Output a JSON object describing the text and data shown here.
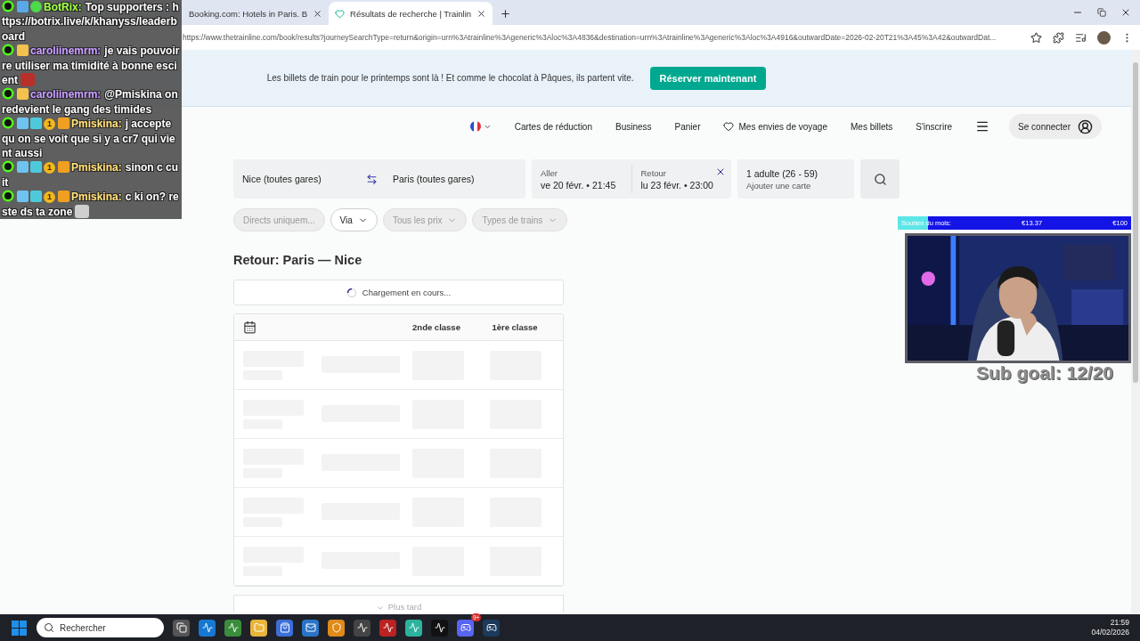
{
  "browser": {
    "tabs": [
      {
        "title": "Booking.com: Hotels in Paris. B",
        "selected": false
      },
      {
        "title": "Résultats de recherche | Trainlin",
        "selected": true
      }
    ],
    "url": "https://www.thetrainline.com/book/results?journeySearchType=return&origin=urn%3Atrainline%3Ageneric%3Aloc%3A4836&destination=urn%3Atrainline%3Ageneric%3Aloc%3A4916&outwardDate=2026-02-20T21%3A45%3A42&outwardDat..."
  },
  "banner": {
    "text": "Les billets de train pour le printemps sont là ! Et comme le chocolat à Pâques, ils partent vite.",
    "button": "Réserver maintenant"
  },
  "nav": {
    "links": [
      {
        "label": "Cartes de réduction",
        "kind": "text"
      },
      {
        "label": "Business",
        "kind": "text"
      },
      {
        "label": "Panier",
        "kind": "text"
      },
      {
        "label": "Mes envies de voyage",
        "kind": "wishlist"
      },
      {
        "label": "Mes billets",
        "kind": "text"
      },
      {
        "label": "S'inscrire",
        "kind": "text"
      }
    ],
    "login": "Se connecter"
  },
  "search": {
    "origin": "Nice (toutes gares)",
    "destination": "Paris (toutes gares)",
    "outbound": {
      "label": "Aller",
      "value": "ve 20 févr. • 21:45"
    },
    "inbound": {
      "label": "Retour",
      "value": "lu 23 févr. • 23:00"
    },
    "passengers": "1 adulte (26 - 59)",
    "card": "Ajouter une carte"
  },
  "filters": [
    {
      "label": "Directs uniquem...",
      "disabled": true,
      "dropdown": false
    },
    {
      "label": "Via",
      "disabled": false,
      "dropdown": true
    },
    {
      "label": "Tous les prix",
      "disabled": true,
      "dropdown": true
    },
    {
      "label": "Types de trains",
      "disabled": true,
      "dropdown": true
    }
  ],
  "results": {
    "title": "Retour: Paris — Nice",
    "loading": "Chargement en cours...",
    "columns": [
      "2nde classe",
      "1ère classe"
    ],
    "rows": [
      {
        "kind": "placeholder"
      },
      {
        "kind": "placeholder"
      },
      {
        "kind": "placeholder"
      },
      {
        "kind": "placeholder"
      },
      {
        "kind": "placeholder"
      }
    ],
    "more": "Plus tard"
  },
  "chat": [
    {
      "kind": "bot",
      "user": "BotRix:",
      "color": "#8ef03c",
      "text": "Top supporters : https://botrix.live/k/khanyss/leaderboard",
      "emote": false
    },
    {
      "kind": "viewer",
      "user": "caroliinemrm:",
      "color": "#b58cf2",
      "text": "je vais pouvoir re utiliser ma timidité à bonne escient",
      "emote": true
    },
    {
      "kind": "viewer",
      "user": "caroliinemrm:",
      "color": "#b58cf2",
      "text": "@Pmiskina on redevient le gang des timides",
      "emote": false
    },
    {
      "kind": "sub",
      "user": "Pmiskina:",
      "color": "#f0c96a",
      "badge": "1",
      "text": "j accepte qu on se voit que si y a cr7 qui vient aussi",
      "emote": false
    },
    {
      "kind": "sub",
      "user": "Pmiskina:",
      "color": "#f0c96a",
      "badge": "1",
      "text": "sinon c cuit",
      "emote": false
    },
    {
      "kind": "sub",
      "user": "Pmiskina:",
      "color": "#f0c96a",
      "badge": "1",
      "text": "c ki on? reste ds ta zone",
      "emote": true
    }
  ],
  "stream": {
    "goal_label": "Soutien du mois:",
    "raised": "€13.37",
    "target": "€100",
    "level": 0.13,
    "sub_goal": "Sub goal: 12/20"
  },
  "taskbar": {
    "search": "Rechercher",
    "discord_badge": "9+",
    "time": "21:59",
    "date": "04/02/2026"
  }
}
